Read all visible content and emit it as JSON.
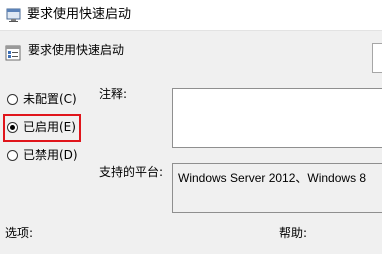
{
  "window": {
    "title": "要求使用快速启动",
    "title_icon": "policy-settings-icon"
  },
  "header": {
    "setting_name": "要求使用快速启动",
    "setting_icon": "policy-document-icon"
  },
  "state_options": [
    {
      "label": "未配置(C)",
      "checked": false
    },
    {
      "label": "已启用(E)",
      "checked": true
    },
    {
      "label": "已禁用(D)",
      "checked": false
    }
  ],
  "highlight_color": "#e0151b",
  "fields": {
    "comment_label": "注释:",
    "comment_value": "",
    "platform_label": "支持的平台:",
    "platform_value": "Windows Server 2012、Windows 8"
  },
  "sections": {
    "options_label": "选项:",
    "help_label": "帮助:"
  }
}
